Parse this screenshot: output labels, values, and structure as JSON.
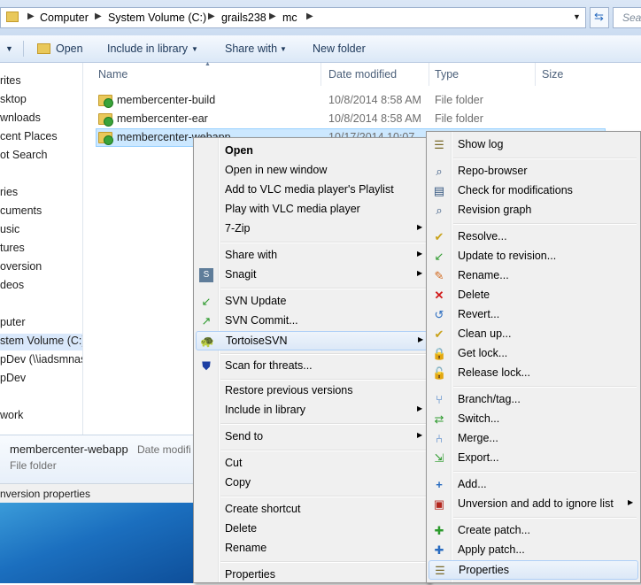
{
  "address": {
    "crumbs": [
      "Computer",
      "System Volume (C:)",
      "grails238",
      "mc"
    ],
    "search_placeholder": "Sear"
  },
  "toolbar": {
    "open": "Open",
    "include_in_library": "Include in library",
    "share_with": "Share with",
    "new_folder": "New folder"
  },
  "nav": {
    "items": [
      "rites",
      "sktop",
      "wnloads",
      "cent Places",
      "ot Search",
      "ries",
      "cuments",
      "usic",
      "tures",
      "oversion",
      "deos",
      "puter",
      "stem Volume (C:)",
      "pDev (\\\\iadsmnas",
      "pDev",
      "work"
    ]
  },
  "filelist": {
    "columns": {
      "name": "Name",
      "date": "Date modified",
      "type": "Type",
      "size": "Size"
    },
    "rows": [
      {
        "name": "membercenter-build",
        "date": "10/8/2014 8:58 AM",
        "type": "File folder"
      },
      {
        "name": "membercenter-ear",
        "date": "10/8/2014 8:58 AM",
        "type": "File folder"
      },
      {
        "name": "membercenter-webapp",
        "date": "10/17/2014 10:07",
        "type": ""
      }
    ]
  },
  "details": {
    "name": "membercenter-webapp",
    "date_label": "Date modifi",
    "type": "File folder"
  },
  "status": {
    "text": "nversion properties"
  },
  "context_menu": {
    "items": [
      {
        "label": "Open",
        "bold": true
      },
      {
        "label": "Open in new window"
      },
      {
        "label": "Add to VLC media player's Playlist"
      },
      {
        "label": "Play with VLC media player"
      },
      {
        "label": "7-Zip",
        "submenu": true
      },
      {
        "label": "Share with",
        "submenu": true
      },
      {
        "label": "Snagit",
        "submenu": true,
        "icon": "snagit-icon"
      },
      {
        "label": "SVN Update",
        "icon": "svn-update-icon"
      },
      {
        "label": "SVN Commit...",
        "icon": "svn-commit-icon"
      },
      {
        "label": "TortoiseSVN",
        "submenu": true,
        "icon": "tortoisesvn-icon"
      },
      {
        "label": "Scan for threats...",
        "icon": "shield-icon"
      },
      {
        "label": "Restore previous versions"
      },
      {
        "label": "Include in library",
        "submenu": true
      },
      {
        "label": "Send to",
        "submenu": true
      },
      {
        "label": "Cut"
      },
      {
        "label": "Copy"
      },
      {
        "label": "Create shortcut"
      },
      {
        "label": "Delete"
      },
      {
        "label": "Rename"
      },
      {
        "label": "Properties"
      }
    ]
  },
  "svn_menu": {
    "items": [
      {
        "label": "Show log",
        "icon": "show-log-icon"
      },
      {
        "label": "Repo-browser",
        "icon": "repo-browser-icon"
      },
      {
        "label": "Check for modifications",
        "icon": "check-modifications-icon"
      },
      {
        "label": "Revision graph",
        "icon": "revision-graph-icon"
      },
      {
        "label": "Resolve...",
        "icon": "resolve-icon"
      },
      {
        "label": "Update to revision...",
        "icon": "update-revision-icon"
      },
      {
        "label": "Rename...",
        "icon": "rename-icon"
      },
      {
        "label": "Delete",
        "icon": "delete-icon"
      },
      {
        "label": "Revert...",
        "icon": "revert-icon"
      },
      {
        "label": "Clean up...",
        "icon": "cleanup-icon"
      },
      {
        "label": "Get lock...",
        "icon": "get-lock-icon"
      },
      {
        "label": "Release lock...",
        "icon": "release-lock-icon"
      },
      {
        "label": "Branch/tag...",
        "icon": "branch-tag-icon"
      },
      {
        "label": "Switch...",
        "icon": "switch-icon"
      },
      {
        "label": "Merge...",
        "icon": "merge-icon"
      },
      {
        "label": "Export...",
        "icon": "export-icon"
      },
      {
        "label": "Add...",
        "icon": "add-icon"
      },
      {
        "label": "Unversion and add to ignore list",
        "icon": "ignore-list-icon",
        "submenu": true
      },
      {
        "label": "Create patch...",
        "icon": "create-patch-icon"
      },
      {
        "label": "Apply patch...",
        "icon": "apply-patch-icon"
      },
      {
        "label": "Properties",
        "icon": "properties-icon"
      }
    ]
  }
}
